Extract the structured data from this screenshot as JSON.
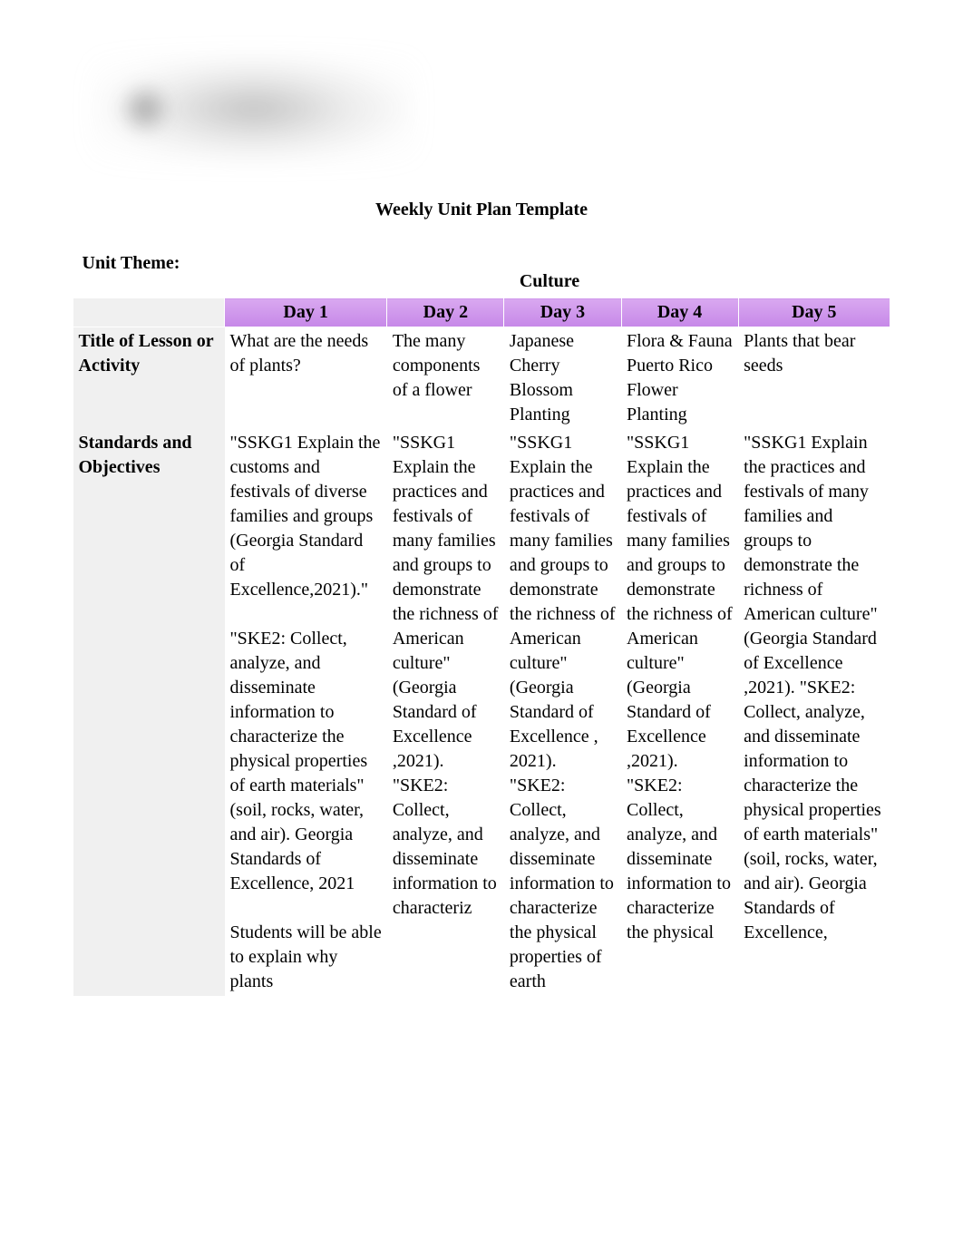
{
  "page_title": "Weekly Unit Plan Template",
  "unit_theme_label": "Unit Theme:",
  "unit_theme_value": "Culture",
  "day_headers": {
    "blank": "",
    "day1": "Day 1",
    "day2": "Day 2",
    "day3": "Day 3",
    "day4": "Day 4",
    "day5": "Day 5"
  },
  "rows": {
    "title_of_lesson": {
      "label": "Title of Lesson or Activity",
      "day1": "What are the needs of plants?",
      "day2": "The many components of a flower",
      "day3": "Japanese Cherry Blossom Planting",
      "day4": "Flora & Fauna Puerto Rico Flower Planting",
      "day5": "Plants that bear seeds"
    },
    "standards": {
      "label": "Standards and Objectives",
      "day1": "\"SSKG1 Explain the customs and festivals of diverse families and groups (Georgia Standard of Excellence,2021).\"\n\n\"SKE2: Collect, analyze, and disseminate information to characterize the physical properties of earth materials\" (soil, rocks, water, and air). Georgia Standards of Excellence, 2021\n\nStudents will be able to explain why plants",
      "day2": "\"SSKG1 Explain the practices and festivals of many families and groups to demonstrate the richness of American culture\" (Georgia Standard of Excellence ,2021). \"SKE2: Collect, analyze, and disseminate information to characteriz",
      "day3": "\"SSKG1 Explain the practices and festivals of many families and groups to demonstrate the richness of American culture\" (Georgia Standard of Excellence , 2021). \"SKE2: Collect, analyze, and disseminate information to characterize the physical properties of earth",
      "day4": "\"SSKG1 Explain the practices and festivals of many families and groups to demonstrate the richness of American culture\" (Georgia Standard of Excellence ,2021). \"SKE2: Collect, analyze, and disseminate information to characterize the physical",
      "day5": "\"SSKG1 Explain the practices and festivals of many families and groups to demonstrate the richness of American culture\" (Georgia Standard of Excellence ,2021). \"SKE2: Collect, analyze, and disseminate information to characterize the physical properties of earth materials\" (soil, rocks, water, and air). Georgia Standards of Excellence,"
    }
  }
}
